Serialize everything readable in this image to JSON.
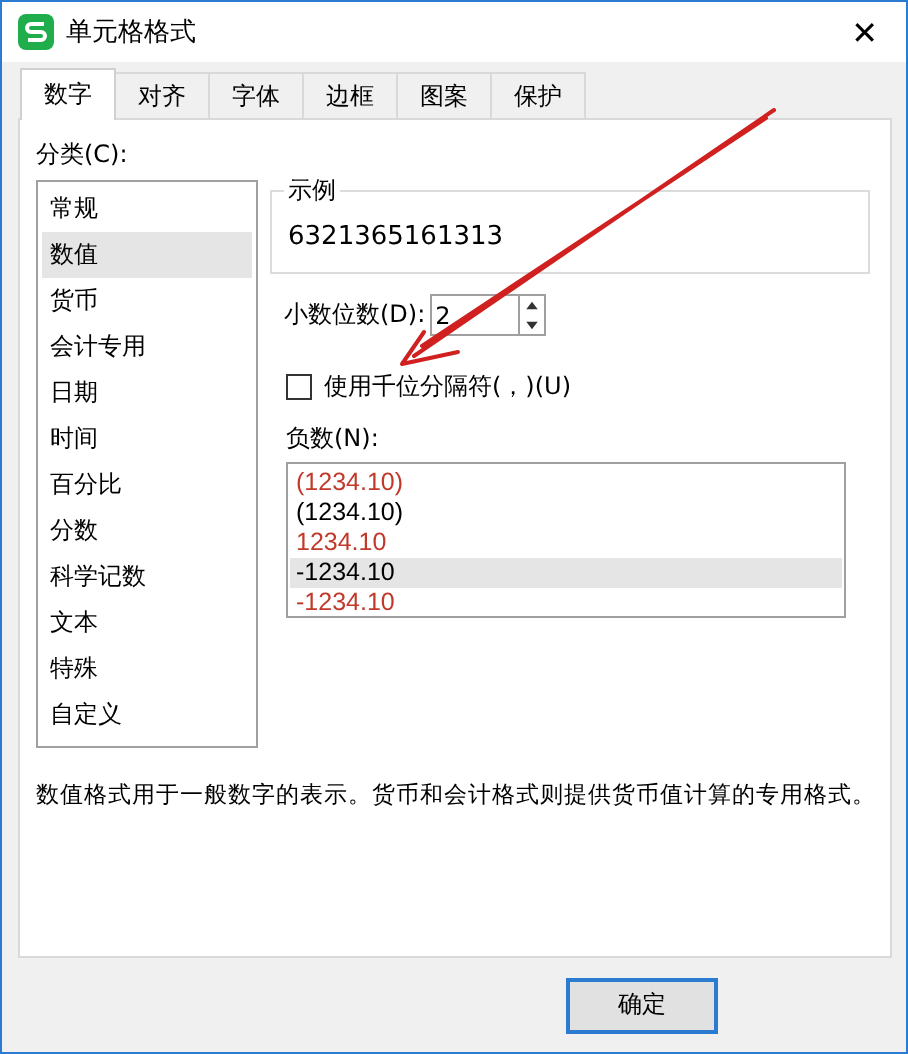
{
  "window": {
    "title": "单元格格式",
    "close": "✕"
  },
  "tabs": [
    {
      "label": "数字",
      "selected": true
    },
    {
      "label": "对齐",
      "selected": false
    },
    {
      "label": "字体",
      "selected": false
    },
    {
      "label": "边框",
      "selected": false
    },
    {
      "label": "图案",
      "selected": false
    },
    {
      "label": "保护",
      "selected": false
    }
  ],
  "category": {
    "label": "分类(C):",
    "items": [
      {
        "label": "常规",
        "selected": false
      },
      {
        "label": "数值",
        "selected": true
      },
      {
        "label": "货币",
        "selected": false
      },
      {
        "label": "会计专用",
        "selected": false
      },
      {
        "label": "日期",
        "selected": false
      },
      {
        "label": "时间",
        "selected": false
      },
      {
        "label": "百分比",
        "selected": false
      },
      {
        "label": "分数",
        "selected": false
      },
      {
        "label": "科学记数",
        "selected": false
      },
      {
        "label": "文本",
        "selected": false
      },
      {
        "label": "特殊",
        "selected": false
      },
      {
        "label": "自定义",
        "selected": false
      }
    ]
  },
  "sample": {
    "label": "示例",
    "value": "6321365161313"
  },
  "decimals": {
    "label": "小数位数(D):",
    "value": "2"
  },
  "thousands_separator": {
    "label": "使用千位分隔符(，)(U)",
    "checked": false
  },
  "negative": {
    "label": "负数(N):",
    "items": [
      {
        "label": "(1234.10)",
        "color": "#c0392b",
        "selected": false
      },
      {
        "label": "(1234.10)",
        "color": "#000000",
        "selected": false
      },
      {
        "label": "1234.10",
        "color": "#c0392b",
        "selected": false
      },
      {
        "label": "-1234.10",
        "color": "#000000",
        "selected": true
      },
      {
        "label": "-1234.10",
        "color": "#c0392b",
        "selected": false
      }
    ]
  },
  "description": "数值格式用于一般数字的表示。货币和会计格式则提供货币值计算的专用格式。",
  "buttons": [
    "确定"
  ]
}
